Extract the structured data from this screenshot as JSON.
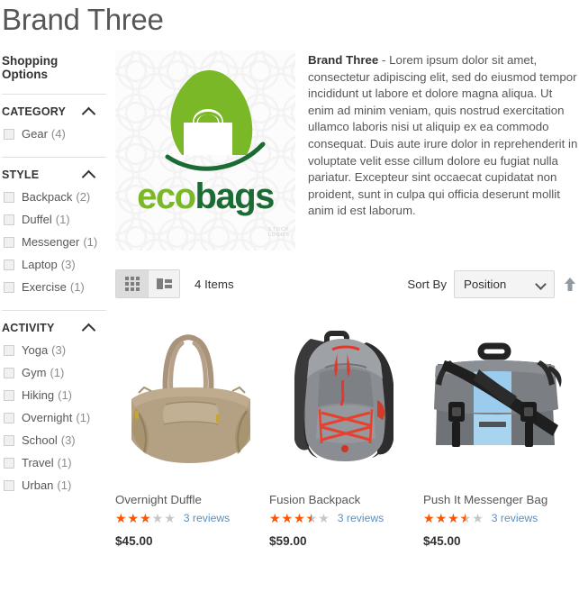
{
  "page": {
    "title": "Brand Three"
  },
  "sidebar": {
    "heading": "Shopping Options",
    "blocks": [
      {
        "label": "CATEGORY",
        "items": [
          {
            "label": "Gear",
            "count": "(4)"
          }
        ]
      },
      {
        "label": "STYLE",
        "items": [
          {
            "label": "Backpack",
            "count": "(2)"
          },
          {
            "label": "Duffel",
            "count": "(1)"
          },
          {
            "label": "Messenger",
            "count": "(1)"
          },
          {
            "label": "Laptop",
            "count": "(3)"
          },
          {
            "label": "Exercise",
            "count": "(1)"
          }
        ]
      },
      {
        "label": "ACTIVITY",
        "items": [
          {
            "label": "Yoga",
            "count": "(3)"
          },
          {
            "label": "Gym",
            "count": "(1)"
          },
          {
            "label": "Hiking",
            "count": "(1)"
          },
          {
            "label": "Overnight",
            "count": "(1)"
          },
          {
            "label": "School",
            "count": "(3)"
          },
          {
            "label": "Travel",
            "count": "(1)"
          },
          {
            "label": "Urban",
            "count": "(1)"
          }
        ]
      }
    ]
  },
  "brand": {
    "logo": {
      "word_part_one": "eco",
      "word_part_two": "bags",
      "watermark_line_one": "STOCK",
      "watermark_line_two": "LOGOS"
    },
    "name": "Brand Three",
    "separator": " - ",
    "description": "Lorem ipsum dolor sit amet, consectetur adipiscing elit, sed do eiusmod tempor incididunt ut labore et dolore magna aliqua. Ut enim ad minim veniam, quis nostrud exercitation ullamco laboris nisi ut aliquip ex ea commodo consequat. Duis aute irure dolor in reprehenderit in voluptate velit esse cillum dolore eu fugiat nulla pariatur. Excepteur sint occaecat cupidatat non proident, sunt in culpa qui officia deserunt mollit anim id est laborum."
  },
  "toolbar": {
    "grid_mode": "grid-view",
    "list_mode": "list-view",
    "items_count": "4 Items",
    "sort_label": "Sort By",
    "sort_value": "Position",
    "sort_direction": "ascending"
  },
  "products": [
    {
      "name": "Overnight Duffle",
      "rating_percent": 60,
      "reviews": "3 reviews",
      "price": "$45.00"
    },
    {
      "name": "Fusion Backpack",
      "rating_percent": 70,
      "reviews": "3 reviews",
      "price": "$59.00"
    },
    {
      "name": "Push It Messenger Bag",
      "rating_percent": 70,
      "reviews": "3 reviews",
      "price": "$45.00"
    }
  ],
  "colors": {
    "star_filled": "#ff5501",
    "star_empty": "#c7c7c7",
    "review_link": "#5a8fc0",
    "logo_light_green": "#7ab828",
    "logo_dark_green": "#1d6b34",
    "text": "#575757"
  }
}
